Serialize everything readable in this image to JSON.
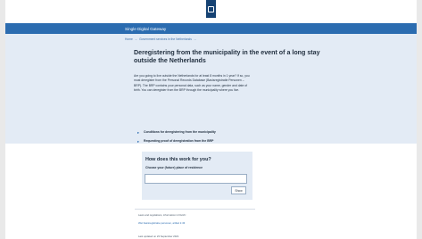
{
  "header": {
    "site_name": "Single Digital Gateway"
  },
  "breadcrumb": {
    "items": [
      "Home",
      "Government services in the Netherlands"
    ],
    "separator": "→"
  },
  "hero": {
    "title": "Deregistering from the municipality in the event of a long stay outside the Netherlands",
    "intro": "Are you going to live outside the Netherlands for at least 8 months in 1 year? If so, you must deregister from the Personal Records Database (Basisregistratie Personen – BRP). The BRP contains your personal data, such as your name, gender and date of birth. You can deregister from the BRP through the municipality where you live."
  },
  "links": [
    {
      "label": "Conditions for deregistering from the municipality",
      "icon": "arrow-right-icon"
    },
    {
      "label": "Requesting proof of deregistration from the BRP",
      "icon": "arrow-right-icon"
    }
  ],
  "card": {
    "heading": "How does this work for you?",
    "field_label": "Choose your (future) place of residence",
    "input_value": "",
    "button_label": "Show"
  },
  "meta": {
    "source": "Laws and regulations, information in Dutch:",
    "link": "Wet basisregistratie personen, artikel 2.43",
    "updated": "Last updated on 23 September 2021"
  },
  "colors": {
    "brand_blue": "#2b6cb0",
    "logo_navy": "#154273",
    "hero_bg": "#e3ebf5"
  }
}
